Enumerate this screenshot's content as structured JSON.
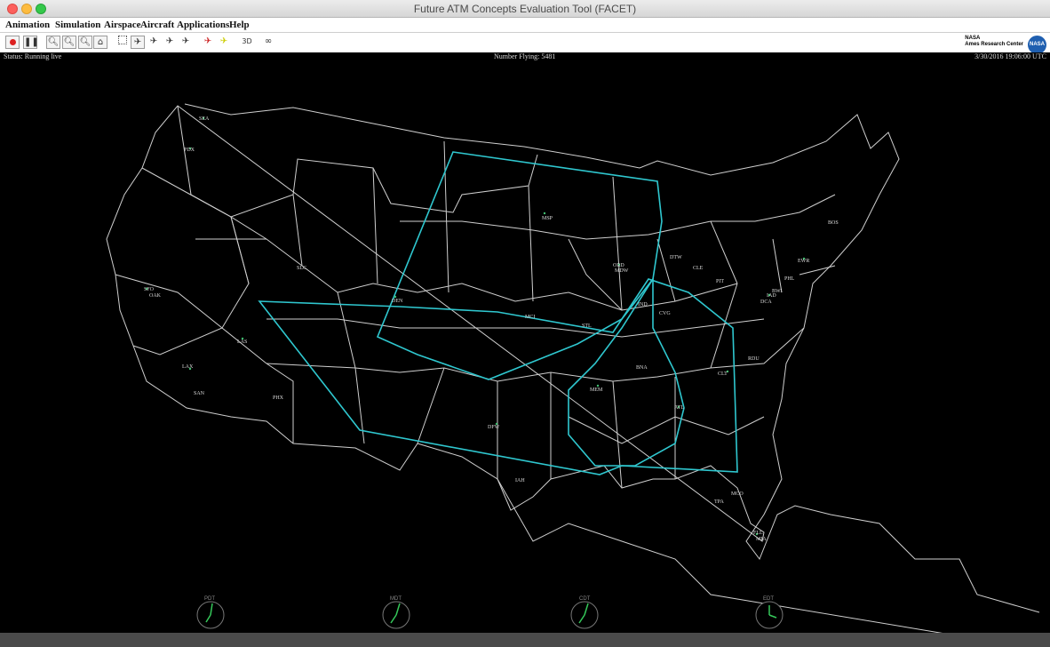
{
  "window": {
    "title": "Future ATM Concepts Evaluation Tool (FACET)"
  },
  "menu": [
    "Animation",
    "Simulation",
    "Airspace",
    "Aircraft",
    "Applications",
    "Help"
  ],
  "toolbar": {
    "buttons": [
      {
        "name": "record-button",
        "icon": "record-icon"
      },
      {
        "name": "pause-button",
        "icon": "pause-icon"
      },
      {
        "name": "zoom-in-button",
        "icon": "zoom-in-icon"
      },
      {
        "name": "zoom-in-alt-button",
        "icon": "zoom-in-icon"
      },
      {
        "name": "zoom-out-button",
        "icon": "zoom-out-icon"
      },
      {
        "name": "home-button",
        "icon": "home-icon"
      },
      {
        "name": "select-region-button",
        "icon": "select-icon"
      },
      {
        "name": "aircraft-select-button",
        "icon": "aircraft-icon"
      },
      {
        "name": "aircraft-button-1",
        "icon": "aircraft-icon"
      },
      {
        "name": "aircraft-button-2",
        "icon": "aircraft-icon"
      },
      {
        "name": "aircraft-button-3",
        "icon": "aircraft-icon"
      },
      {
        "name": "aircraft-alert-button",
        "icon": "aircraft-alert-icon"
      },
      {
        "name": "aircraft-highlight-button",
        "icon": "aircraft-highlight-icon"
      },
      {
        "name": "3d-button",
        "icon": "3d-icon"
      },
      {
        "name": "link-button",
        "icon": "link-icon"
      }
    ],
    "three_d_label": "3D"
  },
  "branding": {
    "line1": "NASA",
    "line2": "Ames Research Center",
    "logo_text": "NASA"
  },
  "status": {
    "left": "Status: Running live",
    "middle": "Number Flying: 5481",
    "right": "3/30/2016  19:06:00 UTC"
  },
  "airports": [
    "SEA",
    "PDX",
    "SFO",
    "OAK",
    "LAX",
    "LAS",
    "SAN",
    "PHX",
    "SLC",
    "DEN",
    "MSP",
    "ORD",
    "MDW",
    "DTW",
    "CLE",
    "STL",
    "MCI",
    "IND",
    "CVG",
    "PIT",
    "BOS",
    "EWR",
    "PHL",
    "DCA",
    "IAD",
    "BWI",
    "RDU",
    "CLT",
    "ATL",
    "MEM",
    "BNA",
    "DFW",
    "IAH",
    "TPA",
    "MCO",
    "FLL",
    "MIA"
  ],
  "clocks": [
    {
      "label": "PDT"
    },
    {
      "label": "MDT"
    },
    {
      "label": "CDT"
    },
    {
      "label": "EDT"
    }
  ],
  "colors": {
    "route": "#2fc7cf",
    "map_lines": "#cfcfcf",
    "background": "#000000",
    "aircraft": "#3fbf6f",
    "menubar": "#ffffff",
    "bottombar": "#4a4a4a"
  }
}
